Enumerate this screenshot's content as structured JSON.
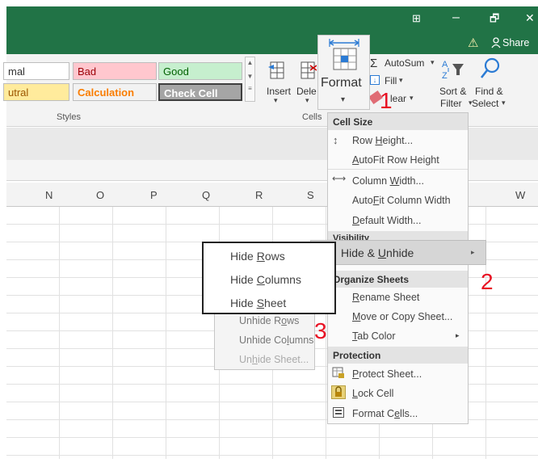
{
  "window": {
    "restore_glyph": "⧉",
    "minimize_glyph": "–",
    "maximize_glyph": "🗗",
    "close_glyph": "✕",
    "ribbon_options_glyph": "⊞",
    "warning_glyph": "⚠",
    "share_label": "Share"
  },
  "styles_gallery": {
    "cells": [
      {
        "label": "mal",
        "bg": "#ffffff",
        "color": "#333333"
      },
      {
        "label": "Bad",
        "bg": "#ffc7ce",
        "color": "#9c0006"
      },
      {
        "label": "Good",
        "bg": "#c6efce",
        "color": "#006100"
      },
      {
        "label": "utral",
        "bg": "#ffeb9c",
        "color": "#9c5700"
      },
      {
        "label": "Calculation",
        "bg": "#f2f2f2",
        "color": "#fa7d00"
      },
      {
        "label": "Check Cell",
        "bg": "#a5a5a5",
        "color": "#ffffff"
      }
    ],
    "group_label": "Styles"
  },
  "cells_group": {
    "insert_label": "Insert",
    "delete_label": "Dele",
    "format_label": "Format",
    "format_caret": "▾",
    "group_label": "Cells"
  },
  "editing_group": {
    "autosum_label": "AutoSum",
    "fill_label": "Fill",
    "clear_label": "lear",
    "sort_label_1": "Sort &",
    "sort_label_2": "Filter",
    "find_label_1": "Find &",
    "find_label_2": "Select"
  },
  "columns": [
    "N",
    "O",
    "P",
    "Q",
    "R",
    "S",
    "W"
  ],
  "format_menu": {
    "section_cell_size": "Cell Size",
    "row_height_pre": "Row ",
    "row_height_u": "H",
    "row_height_post": "eight...",
    "autofit_row_pre": "",
    "autofit_row_u": "A",
    "autofit_row_post": "utoFit Row Height",
    "column_width_pre": "Column ",
    "column_width_u": "W",
    "column_width_post": "idth...",
    "autofit_col_pre": "Auto",
    "autofit_col_u": "F",
    "autofit_col_post": "it Column Width",
    "default_width_pre": "",
    "default_width_u": "D",
    "default_width_post": "efault Width...",
    "section_visibility": "Visibility",
    "hide_unhide_pre": "Hide & ",
    "hide_unhide_u": "U",
    "hide_unhide_post": "nhide",
    "section_organize": "Organize Sheets",
    "rename_pre": "",
    "rename_u": "R",
    "rename_post": "ename Sheet",
    "move_copy_pre": "",
    "move_copy_u": "M",
    "move_copy_post": "ove or Copy Sheet...",
    "tab_color_pre": "",
    "tab_color_u": "T",
    "tab_color_post": "ab Color",
    "section_protection": "Protection",
    "protect_pre": "",
    "protect_u": "P",
    "protect_post": "rotect Sheet...",
    "lock_pre": "",
    "lock_u": "L",
    "lock_post": "ock Cell",
    "format_cells_pre": "Format C",
    "format_cells_u": "e",
    "format_cells_post": "lls..."
  },
  "submenu": {
    "hide_rows_pre": "Hide ",
    "hide_rows_u": "R",
    "hide_rows_post": "ows",
    "hide_columns_pre": "Hide ",
    "hide_columns_u": "C",
    "hide_columns_post": "olumns",
    "hide_sheet_pre": "Hide ",
    "hide_sheet_u": "S",
    "hide_sheet_post": "heet",
    "unhide_rows_pre": "Unhide R",
    "unhide_rows_u": "o",
    "unhide_rows_post": "ws",
    "unhide_columns_pre": "Unhide Co",
    "unhide_columns_u": "l",
    "unhide_columns_post": "umns",
    "unhide_sheet_pre": "Un",
    "unhide_sheet_u": "h",
    "unhide_sheet_post": "ide Sheet..."
  },
  "annotations": {
    "step1": "1",
    "step2": "2",
    "step3": "3",
    "color": "#e81123"
  },
  "colors": {
    "excel_green": "#217346"
  }
}
